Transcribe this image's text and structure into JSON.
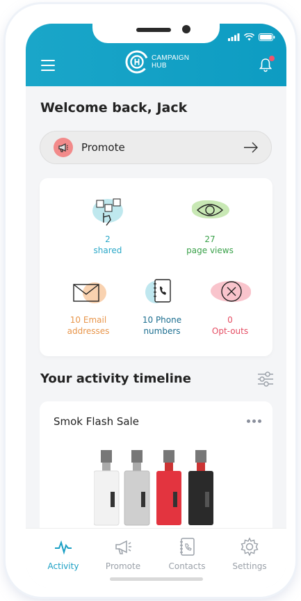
{
  "header": {
    "brand_line1": "CAMPAIGN",
    "brand_line2": "HUB"
  },
  "welcome": "Welcome back, Jack",
  "promote": {
    "label": "Promote"
  },
  "stats": [
    {
      "value": "2",
      "label": "shared",
      "color": "#2aa8c8"
    },
    {
      "value": "27",
      "label": "page views",
      "color": "#3aa14a"
    },
    {
      "value": "10 Email",
      "label": "addresses",
      "color": "#e8954a"
    },
    {
      "value": "10 Phone",
      "label": "numbers",
      "color": "#1a6d8f"
    },
    {
      "value": "0",
      "label": "Opt-outs",
      "color": "#e54c62"
    }
  ],
  "timeline": {
    "title": "Your activity timeline",
    "card_title": "Smok Flash Sale"
  },
  "tabs": [
    {
      "label": "Activity",
      "icon": "activity-icon",
      "active": true
    },
    {
      "label": "Promote",
      "icon": "megaphone-icon",
      "active": false
    },
    {
      "label": "Contacts",
      "icon": "contacts-icon",
      "active": false
    },
    {
      "label": "Settings",
      "icon": "gear-icon",
      "active": false
    }
  ],
  "colors": {
    "header": "#14a3c6",
    "active_tab": "#1a9fc4",
    "inactive_tab": "#9aa0a8"
  }
}
